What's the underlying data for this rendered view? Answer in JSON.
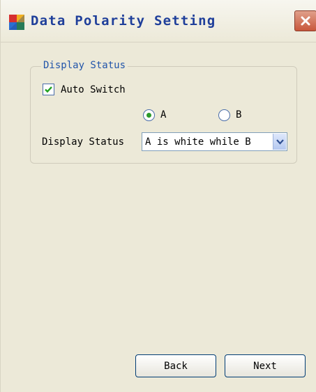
{
  "window": {
    "title": "Data Polarity Setting",
    "accent_title_color": "#1f3f9a",
    "icons": {
      "app": "app-colorful-square-icon",
      "close": "close-icon"
    }
  },
  "group": {
    "legend": "Display Status",
    "auto_switch": {
      "label": "Auto Switch",
      "checked": true
    },
    "radios": [
      {
        "label": "A",
        "selected": true
      },
      {
        "label": "B",
        "selected": false
      }
    ],
    "display_status": {
      "label": "Display Status",
      "value": "A is white while B",
      "dropdown_icon": "chevron-down-icon"
    }
  },
  "buttons": {
    "back": "Back",
    "next": "Next"
  }
}
